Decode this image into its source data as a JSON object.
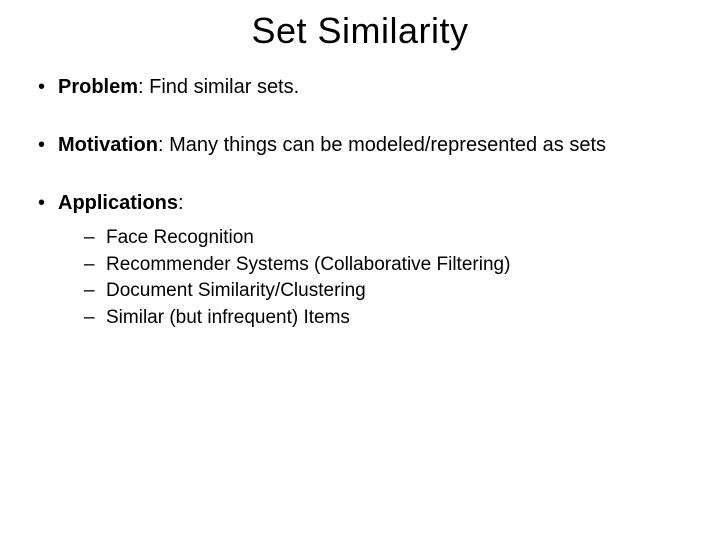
{
  "title": "Set Similarity",
  "bullets": {
    "0": {
      "label": "Problem",
      "text": ": Find similar sets."
    },
    "1": {
      "label": "Motivation",
      "text": ": Many things can be modeled/represented as sets"
    },
    "2": {
      "label": "Applications",
      "text": ":",
      "sub": {
        "0": "Face Recognition",
        "1": "Recommender Systems (Collaborative Filtering)",
        "2": "Document Similarity/Clustering",
        "3": "Similar (but infrequent) Items"
      }
    }
  }
}
